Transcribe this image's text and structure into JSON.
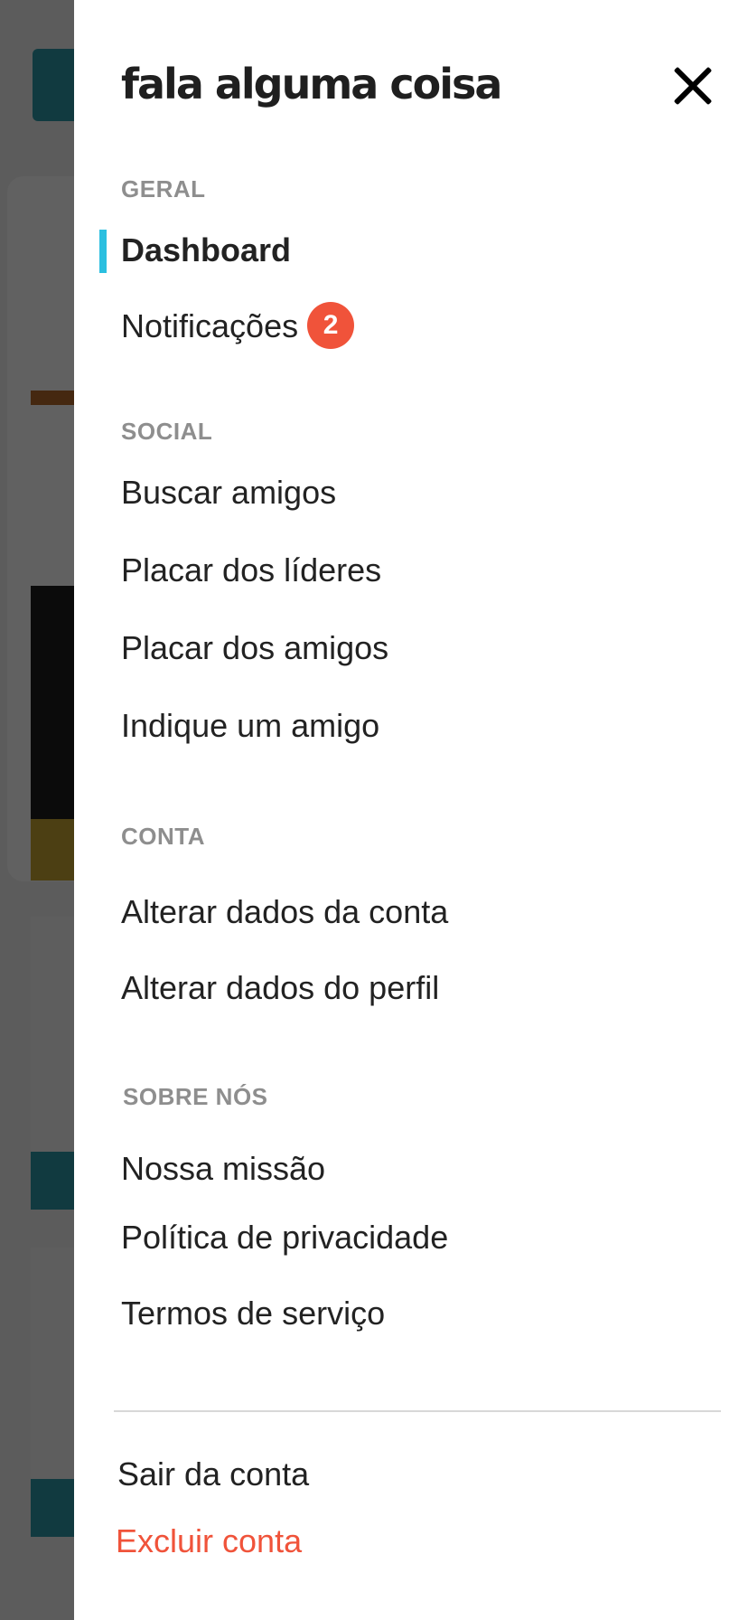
{
  "app": {
    "brand": "fala alguma coisa"
  },
  "sections": {
    "geral": "GERAL",
    "social": "SOCIAL",
    "conta": "CONTA",
    "sobre": "SOBRE NÓS"
  },
  "nav": {
    "dashboard": "Dashboard",
    "notificacoes": "Notificações",
    "notificacoes_count": "2",
    "buscar_amigos": "Buscar amigos",
    "placar_lideres": "Placar dos líderes",
    "placar_amigos": "Placar dos amigos",
    "indique": "Indique um amigo",
    "alterar_conta": "Alterar dados da conta",
    "alterar_perfil": "Alterar dados do perfil",
    "missao": "Nossa missão",
    "privacidade": "Política de privacidade",
    "termos": "Termos de serviço"
  },
  "footer": {
    "logout": "Sair da conta",
    "delete": "Excluir conta"
  },
  "colors": {
    "active_indicator": "#2bbfe0",
    "badge": "#f0533a",
    "danger": "#f0533a"
  }
}
